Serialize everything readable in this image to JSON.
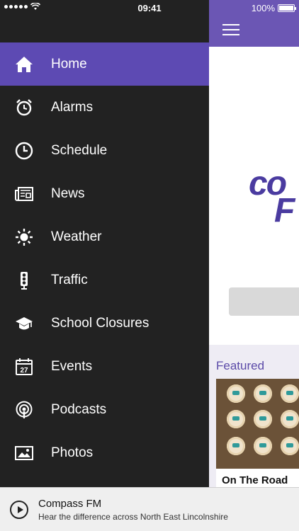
{
  "status_bar": {
    "time": "09:41",
    "battery": "100%"
  },
  "menu": {
    "items": [
      {
        "label": "Home",
        "icon": "home-icon",
        "active": true
      },
      {
        "label": "Alarms",
        "icon": "alarm-clock-icon",
        "active": false
      },
      {
        "label": "Schedule",
        "icon": "clock-icon",
        "active": false
      },
      {
        "label": "News",
        "icon": "newspaper-icon",
        "active": false
      },
      {
        "label": "Weather",
        "icon": "sun-icon",
        "active": false
      },
      {
        "label": "Traffic",
        "icon": "traffic-light-icon",
        "active": false
      },
      {
        "label": "School Closures",
        "icon": "graduation-cap-icon",
        "active": false
      },
      {
        "label": "Events",
        "icon": "calendar-icon",
        "active": false
      },
      {
        "label": "Podcasts",
        "icon": "podcast-icon",
        "active": false
      },
      {
        "label": "Photos",
        "icon": "photos-icon",
        "active": false
      }
    ],
    "calendar_day": "27"
  },
  "main": {
    "logo_line1": "co",
    "logo_line2": "F",
    "featured_label": "Featured",
    "featured_title": "On The Road"
  },
  "player": {
    "title": "Compass FM",
    "subtitle": "Hear the difference across North East Lincolnshire"
  },
  "colors": {
    "accent": "#5d4ab3",
    "header": "#6b56b4",
    "drawer": "#222222"
  }
}
